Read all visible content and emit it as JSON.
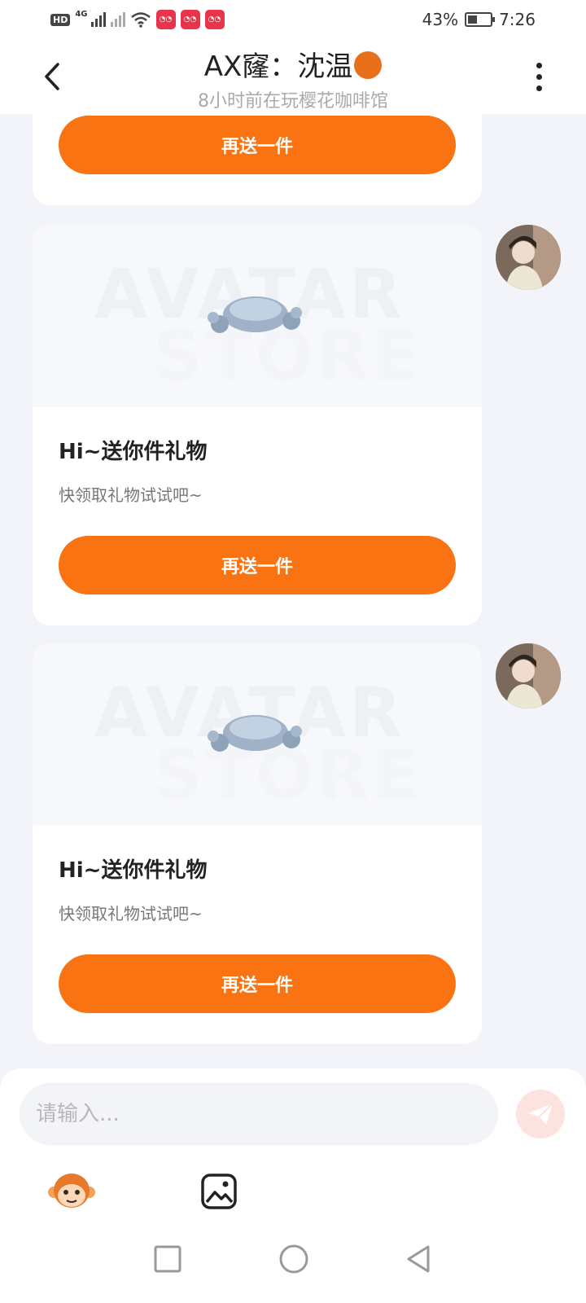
{
  "status_bar": {
    "hd": "HD",
    "net": "4G",
    "battery_percent": "43%",
    "battery_level": 0.43,
    "time": "7:26",
    "icons": [
      "signal-icon",
      "wifi-icon",
      "app-notification-icon"
    ]
  },
  "header": {
    "title": "AX窿：沈温",
    "subtitle": "8小时前在玩樱花咖啡馆",
    "back_icon": "chevron-left-icon",
    "more_icon": "more-vertical-icon"
  },
  "messages": [
    {
      "resend_label": "再送一件"
    },
    {
      "title": "Hi~送你件礼物",
      "desc": "快领取礼物试试吧~",
      "resend_label": "再送一件",
      "watermark": [
        "AVATAR",
        "STORE"
      ]
    },
    {
      "title": "Hi~送你件礼物",
      "desc": "快领取礼物试试吧~",
      "resend_label": "再送一件",
      "watermark": [
        "AVATAR",
        "STORE"
      ]
    }
  ],
  "composer": {
    "placeholder": "请输入...",
    "send_icon": "send-icon",
    "emoji_icon": "monkey-emoji-icon",
    "image_icon": "image-icon"
  },
  "colors": {
    "accent": "#f97312",
    "send_disabled": "#fde3dd",
    "background": "#f2f4f9"
  },
  "navbar": [
    "recents-icon",
    "home-icon",
    "back-icon"
  ]
}
